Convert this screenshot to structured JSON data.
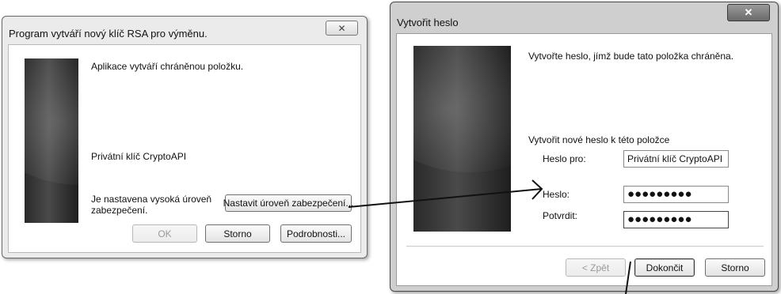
{
  "dialog1": {
    "title": "Program vytváří nový klíč RSA pro výměnu.",
    "close_glyph": "✕",
    "message": "Aplikace vytváří chráněnou položku.",
    "item_name": "Privátní klíč CryptoAPI",
    "security_level_line1": "Je nastavena vysoká úroveň",
    "security_level_line2": "zabezpečení.",
    "set_security_level_button": "Nastavit úroveň zabezpečení...",
    "ok_button": "OK",
    "cancel_button": "Storno",
    "details_button": "Podrobnosti..."
  },
  "dialog2": {
    "title": "Vytvořit heslo",
    "close_glyph": "✕",
    "message": "Vytvořte heslo, jímž bude tato položka chráněna.",
    "section_label": "Vytvořit nové heslo k této položce",
    "password_for_label": "Heslo pro:",
    "password_for_value": "Privátní klíč CryptoAPI",
    "password_label": "Heslo:",
    "password_value": "●●●●●●●●●",
    "confirm_label": "Potvrdit:",
    "confirm_value": "●●●●●●●●●",
    "back_button": "< Zpět",
    "finish_button": "Dokončit",
    "cancel_button": "Storno"
  }
}
